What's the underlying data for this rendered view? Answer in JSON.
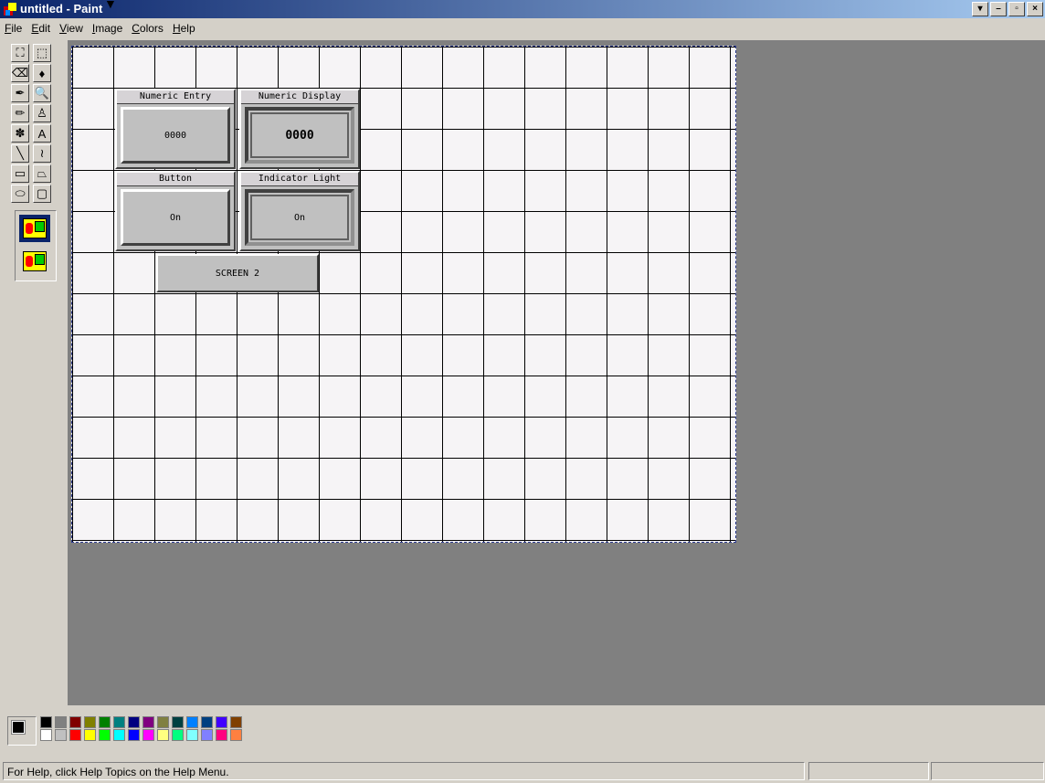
{
  "window": {
    "title": "untitled - Paint",
    "buttons": [
      "▾",
      "–",
      "▫",
      "×"
    ]
  },
  "menu": [
    "File",
    "Edit",
    "View",
    "Image",
    "Colors",
    "Help"
  ],
  "tools": [
    {
      "name": "free-select-icon",
      "glyph": "⛶"
    },
    {
      "name": "rect-select-icon",
      "glyph": "⬚"
    },
    {
      "name": "eraser-icon",
      "glyph": "⌫"
    },
    {
      "name": "fill-bucket-icon",
      "glyph": "♦"
    },
    {
      "name": "color-picker-icon",
      "glyph": "✒"
    },
    {
      "name": "magnifier-icon",
      "glyph": "🔍"
    },
    {
      "name": "pencil-icon",
      "glyph": "✏"
    },
    {
      "name": "brush-icon",
      "glyph": "♙"
    },
    {
      "name": "airbrush-icon",
      "glyph": "✽"
    },
    {
      "name": "text-icon",
      "glyph": "A"
    },
    {
      "name": "line-icon",
      "glyph": "╲"
    },
    {
      "name": "curve-icon",
      "glyph": "≀"
    },
    {
      "name": "rectangle-icon",
      "glyph": "▭"
    },
    {
      "name": "polygon-icon",
      "glyph": "⏢"
    },
    {
      "name": "ellipse-icon",
      "glyph": "⬭"
    },
    {
      "name": "rounded-rect-icon",
      "glyph": "▢"
    }
  ],
  "canvas": {
    "numeric_entry": {
      "label": "Numeric Entry",
      "value": "0000"
    },
    "numeric_display": {
      "label": "Numeric Display",
      "value": "0000"
    },
    "button": {
      "label": "Button",
      "value": "On"
    },
    "indicator": {
      "label": "Indicator Light",
      "value": "On"
    },
    "screen_button": "SCREEN 2"
  },
  "palette": {
    "row1": [
      "#000000",
      "#808080",
      "#800000",
      "#808000",
      "#008000",
      "#008080",
      "#000080",
      "#800080",
      "#808040",
      "#004040",
      "#0080ff",
      "#004080",
      "#4000ff",
      "#804000"
    ],
    "row2": [
      "#ffffff",
      "#c0c0c0",
      "#ff0000",
      "#ffff00",
      "#00ff00",
      "#00ffff",
      "#0000ff",
      "#ff00ff",
      "#ffff80",
      "#00ff80",
      "#80ffff",
      "#8080ff",
      "#ff0080",
      "#ff8040"
    ]
  },
  "status": {
    "help_text": "For Help, click Help Topics on the Help Menu."
  }
}
